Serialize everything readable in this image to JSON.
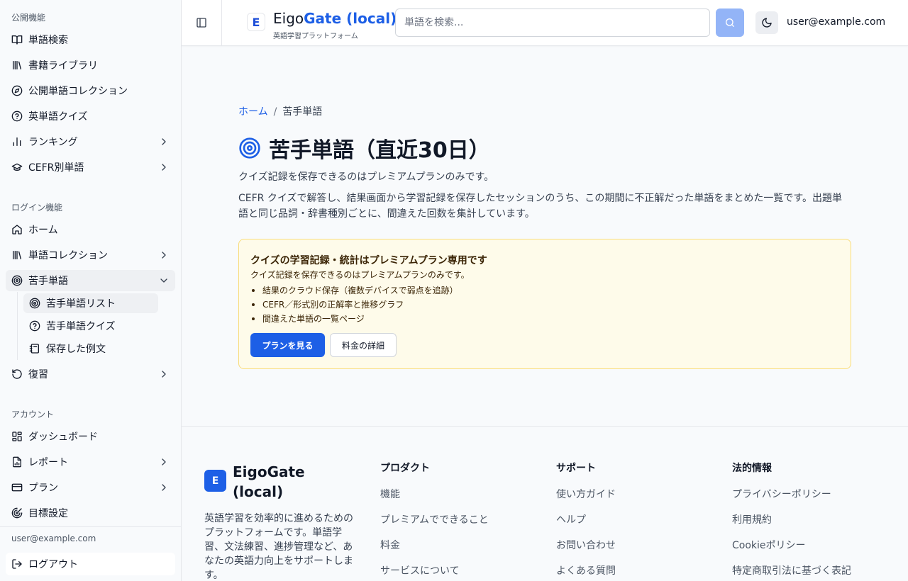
{
  "sidebar": {
    "public_label": "公開機能",
    "public_items": [
      {
        "label": "単語検索",
        "icon": "book-open-icon"
      },
      {
        "label": "書籍ライブラリ",
        "icon": "library-icon"
      },
      {
        "label": "公開単語コレクション",
        "icon": "compass-icon"
      },
      {
        "label": "英単語クイズ",
        "icon": "help-circle-icon"
      },
      {
        "label": "ランキング",
        "icon": "bar-chart-icon"
      },
      {
        "label": "CEFR別単語",
        "icon": "graduation-cap-icon"
      }
    ],
    "login_label": "ログイン機能",
    "login_items": [
      {
        "label": "ホーム",
        "icon": "home-icon"
      },
      {
        "label": "単語コレクション",
        "icon": "library-icon"
      },
      {
        "label": "苦手単語",
        "icon": "target-icon"
      },
      {
        "label": "復習",
        "icon": "rotate-ccw-icon"
      }
    ],
    "weak_sub_items": [
      {
        "label": "苦手単語リスト",
        "icon": "target-icon"
      },
      {
        "label": "苦手単語クイズ",
        "icon": "help-circle-icon"
      },
      {
        "label": "保存した例文",
        "icon": "notebook-icon"
      }
    ],
    "account_label": "アカウント",
    "account_items": [
      {
        "label": "ダッシュボード",
        "icon": "layout-grid-icon"
      },
      {
        "label": "レポート",
        "icon": "file-chart-icon"
      },
      {
        "label": "プラン",
        "icon": "credit-card-icon"
      },
      {
        "label": "目標設定",
        "icon": "goal-icon"
      }
    ],
    "user_email": "user@example.com",
    "logout_label": "ログアウト"
  },
  "header": {
    "brand_main": "Eigo",
    "brand_accent": "Gate (local)",
    "brand_sub": "英語学習プラットフォーム",
    "logo_letter": "E",
    "search_placeholder": "単語を検索...",
    "user_email": "user@example.com"
  },
  "main": {
    "breadcrumb_home": "ホーム",
    "breadcrumb_sep": "/",
    "breadcrumb_current": "苦手単語",
    "title": "苦手単語（直近30日）",
    "notice": "クイズ記録を保存できるのはプレミアムプランのみです。",
    "description": "CEFR クイズで解答し、結果画面から学習記録を保存したセッションのうち、この期間に不正解だった単語をまとめた一覧です。出題単語と同じ品詞・辞書種別ごとに、間違えた回数を集計しています。",
    "premium": {
      "title": "クイズの学習記録・統計はプレミアムプラン専用です",
      "desc": "クイズ記録を保存できるのはプレミアムプランのみです。",
      "features": [
        "結果のクラウド保存（複数デバイスで弱点を追跡）",
        "CEFR／形式別の正解率と推移グラフ",
        "間違えた単語の一覧ページ"
      ],
      "primary_button": "プランを見る",
      "secondary_button": "料金の詳細"
    }
  },
  "footer": {
    "logo_letter": "E",
    "brand": "EigoGate (local)",
    "description": "英語学習を効率的に進めるためのプラットフォームです。単語学習、文法練習、進捗管理など、あなたの英語力向上をサポートします。",
    "columns": [
      {
        "title": "プロダクト",
        "links": [
          "機能",
          "プレミアムでできること",
          "料金",
          "サービスについて"
        ]
      },
      {
        "title": "サポート",
        "links": [
          "使い方ガイド",
          "ヘルプ",
          "お問い合わせ",
          "よくある質問"
        ]
      },
      {
        "title": "法的情報",
        "links": [
          "プライバシーポリシー",
          "利用規約",
          "Cookieポリシー",
          "特定商取引法に基づく表記"
        ]
      }
    ]
  },
  "colors": {
    "accent": "#1d5fe6",
    "premium_bg": "#fefbea",
    "premium_border": "#f9dc7a"
  }
}
